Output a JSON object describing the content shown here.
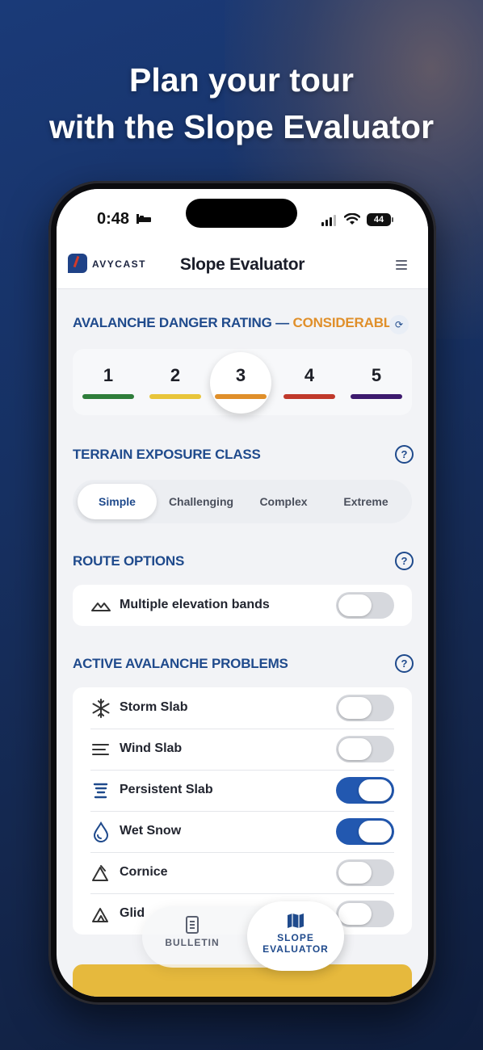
{
  "promo": {
    "line1": "Plan your tour",
    "line2": "with the Slope Evaluator"
  },
  "status_bar": {
    "time": "0:48",
    "battery": "44"
  },
  "app": {
    "brand": "AVYCAST",
    "title": "Slope Evaluator"
  },
  "danger": {
    "heading": "AVALANCHE DANGER RATING",
    "separator": "—",
    "value": "CONSIDERABLE",
    "levels": [
      {
        "label": "1",
        "color": "#2e7d3a"
      },
      {
        "label": "2",
        "color": "#e8c53a"
      },
      {
        "label": "3",
        "color": "#e08f2a"
      },
      {
        "label": "4",
        "color": "#c0392b"
      },
      {
        "label": "5",
        "color": "#3d1a6e"
      }
    ],
    "selected": "3"
  },
  "terrain": {
    "heading": "TERRAIN EXPOSURE CLASS",
    "options": [
      "Simple",
      "Challenging",
      "Complex",
      "Extreme"
    ],
    "selected": "Simple"
  },
  "route": {
    "heading": "ROUTE OPTIONS",
    "items": [
      {
        "label": "Multiple elevation bands",
        "on": false,
        "icon": "mountains-icon"
      }
    ]
  },
  "problems": {
    "heading": "ACTIVE AVALANCHE PROBLEMS",
    "items": [
      {
        "label": "Storm Slab",
        "on": false,
        "icon": "snowflake-icon"
      },
      {
        "label": "Wind Slab",
        "on": false,
        "icon": "wind-lines-icon"
      },
      {
        "label": "Persistent Slab",
        "on": true,
        "icon": "layers-icon"
      },
      {
        "label": "Wet Snow",
        "on": true,
        "icon": "droplet-icon"
      },
      {
        "label": "Cornice",
        "on": false,
        "icon": "cornice-icon"
      },
      {
        "label": "Glid",
        "on": false,
        "icon": "glide-icon"
      }
    ]
  },
  "tabs": {
    "bulletin": "BULLETIN",
    "slope_line1": "SLOPE",
    "slope_line2": "EVALUATOR"
  },
  "help_glyph": "?",
  "colors": {
    "accent": "#1f4a8c",
    "danger_text": "#e08f2a",
    "toggle_on": "#2258b0",
    "cta": "#e6b93d"
  }
}
